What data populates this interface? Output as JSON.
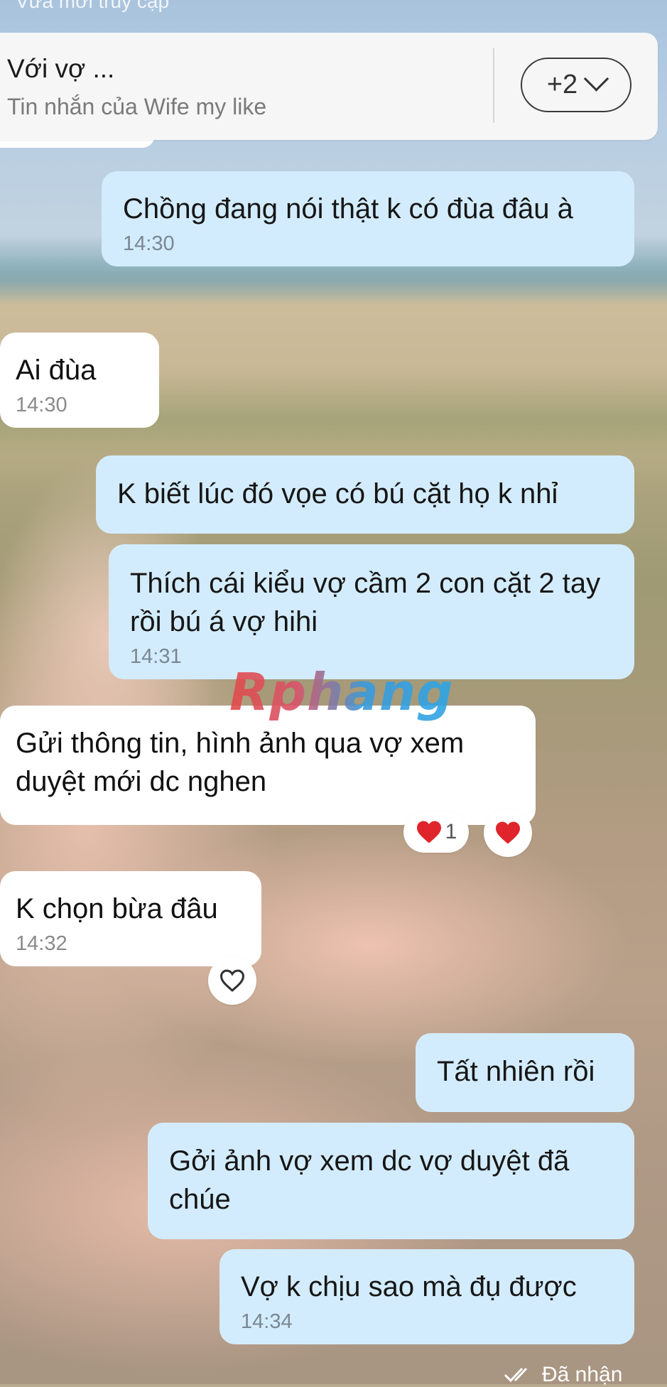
{
  "top_fragment": "Vừa mới truy cập",
  "header": {
    "title": "Với vợ ...",
    "subtitle": "Tin nhắn của Wife my like",
    "participants_label": "+2"
  },
  "messages": [
    {
      "sender": "me",
      "text": "Chồng đang nói thật k có đùa đâu à",
      "time": "14:30"
    },
    {
      "sender": "other",
      "text": "Ai đùa",
      "time": "14:30"
    },
    {
      "sender": "me",
      "text": "K biết lúc đó vọe có bú cặt họ k nhỉ",
      "time": ""
    },
    {
      "sender": "me",
      "text": "Thích cái kiểu vợ cầm 2 con cặt 2 tay rồi bú á vợ hihi",
      "time": "14:31"
    },
    {
      "sender": "other",
      "text": "Gửi thông tin, hình ảnh qua vợ xem duyệt mới dc nghen",
      "time": "",
      "reaction_count": "1"
    },
    {
      "sender": "other",
      "text": "K chọn bừa đâu",
      "time": "14:32"
    },
    {
      "sender": "me",
      "text": "Tất nhiên rồi",
      "time": ""
    },
    {
      "sender": "me",
      "text": "Gởi ảnh vợ xem dc vợ duyệt đã chúe",
      "time": ""
    },
    {
      "sender": "me",
      "text": "Vợ k chịu sao mà đụ được",
      "time": "14:34"
    }
  ],
  "watermark": "Rphang",
  "status": "Đã nhận",
  "colors": {
    "sent_bubble": "#d3ecfd",
    "received_bubble": "#ffffff",
    "reaction_heart": "#e0242b"
  }
}
